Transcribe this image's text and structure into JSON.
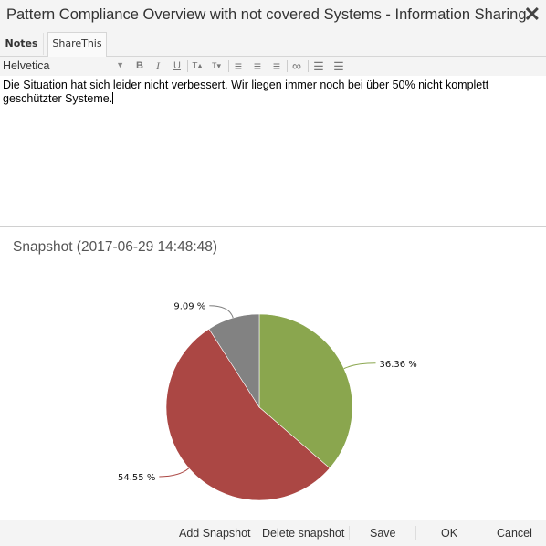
{
  "window": {
    "title": "Pattern Compliance Overview with not covered Systems - Information Sharing",
    "close_icon": "✕"
  },
  "tabs": [
    {
      "label": "Notes",
      "active": true
    },
    {
      "label": "ShareThis",
      "active": false
    }
  ],
  "toolbar": {
    "font": "Helvetica",
    "buttons": [
      {
        "name": "bold",
        "glyph": "B"
      },
      {
        "name": "italic",
        "glyph": "I"
      },
      {
        "name": "underline",
        "glyph": "U"
      },
      {
        "name": "superscript",
        "glyph": "T▴"
      },
      {
        "name": "subscript",
        "glyph": "T▾"
      },
      {
        "name": "align-left",
        "glyph": "≡"
      },
      {
        "name": "align-center",
        "glyph": "≡"
      },
      {
        "name": "align-right",
        "glyph": "≡"
      },
      {
        "name": "link",
        "glyph": "∞"
      },
      {
        "name": "ordered-list",
        "glyph": "☰"
      },
      {
        "name": "unordered-list",
        "glyph": "☰"
      }
    ]
  },
  "editor": {
    "text": "Die Situation hat sich leider nicht verbessert. Wir liegen immer noch bei über 50% nicht komplett geschützter Systeme."
  },
  "snapshot": {
    "title": "Snapshot (2017-06-29 14:48:48)"
  },
  "chart_data": {
    "type": "pie",
    "title": "",
    "slices": [
      {
        "label": "36.36 %",
        "value": 36.36,
        "color": "#8aa64e"
      },
      {
        "label": "54.55 %",
        "value": 54.55,
        "color": "#ab4744"
      },
      {
        "label": "9.09 %",
        "value": 9.09,
        "color": "#828282"
      }
    ],
    "start": "top",
    "direction": "clockwise"
  },
  "footer": {
    "add_snapshot": "Add Snapshot",
    "delete_snapshot": "Delete snapshot",
    "save": "Save",
    "ok": "OK",
    "cancel": "Cancel"
  }
}
